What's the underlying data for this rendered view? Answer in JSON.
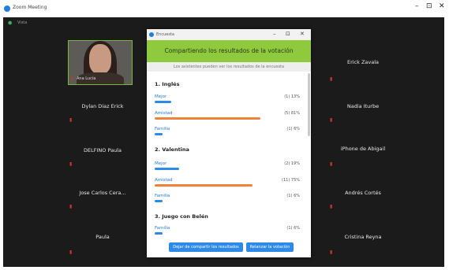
{
  "window": {
    "title": "Zoom Meeting",
    "controls": {
      "minimize": "–",
      "maximize": "⊡",
      "close": "✕"
    }
  },
  "meeting": {
    "top_label": "Vista"
  },
  "participants": [
    {
      "name": "Dylan Diaz Erick"
    },
    {
      "name": "DELFINO Paula"
    },
    {
      "name": "Jose Carlos Cera..."
    },
    {
      "name": "Paula"
    },
    {
      "name": "Erick Zavala"
    },
    {
      "name": "Nadia Iturbe"
    },
    {
      "name": "iPhone de Abigail"
    },
    {
      "name": "Andrés Cortés"
    },
    {
      "name": "Cristina Reyna"
    }
  ],
  "video_participant": {
    "name": "Ana Lucía"
  },
  "poll": {
    "window_title": "Encuesta",
    "banner": "Compartiendo los resultados de la votación",
    "subtitle": "Los asistentes pueden ver los resultados de la encuesta",
    "questions": [
      {
        "title": "1. Inglés",
        "options": [
          {
            "label": "Mejor",
            "pct": "(1) 13%",
            "fraction": 0.13
          },
          {
            "label": "Amistad",
            "pct": "(5) 81%",
            "fraction": 0.81
          },
          {
            "label": "Familia",
            "pct": "(1) 6%",
            "fraction": 0.06
          }
        ]
      },
      {
        "title": "2. Valentina",
        "options": [
          {
            "label": "Mejor",
            "pct": "(2) 19%",
            "fraction": 0.19
          },
          {
            "label": "Amistad",
            "pct": "(11) 75%",
            "fraction": 0.75
          },
          {
            "label": "Familia",
            "pct": "(1) 6%",
            "fraction": 0.06
          }
        ]
      },
      {
        "title": "3. Juego con Belén",
        "options": [
          {
            "label": "Familia",
            "pct": "(1) 6%",
            "fraction": 0.06
          }
        ]
      }
    ],
    "buttons": {
      "stop_sharing": "Dejar de compartir los resultados",
      "relaunch": "Relanzar la votación"
    },
    "colors": {
      "blue": "#2d8ae6",
      "orange": "#f0833a",
      "banner": "#8fca3e"
    }
  }
}
